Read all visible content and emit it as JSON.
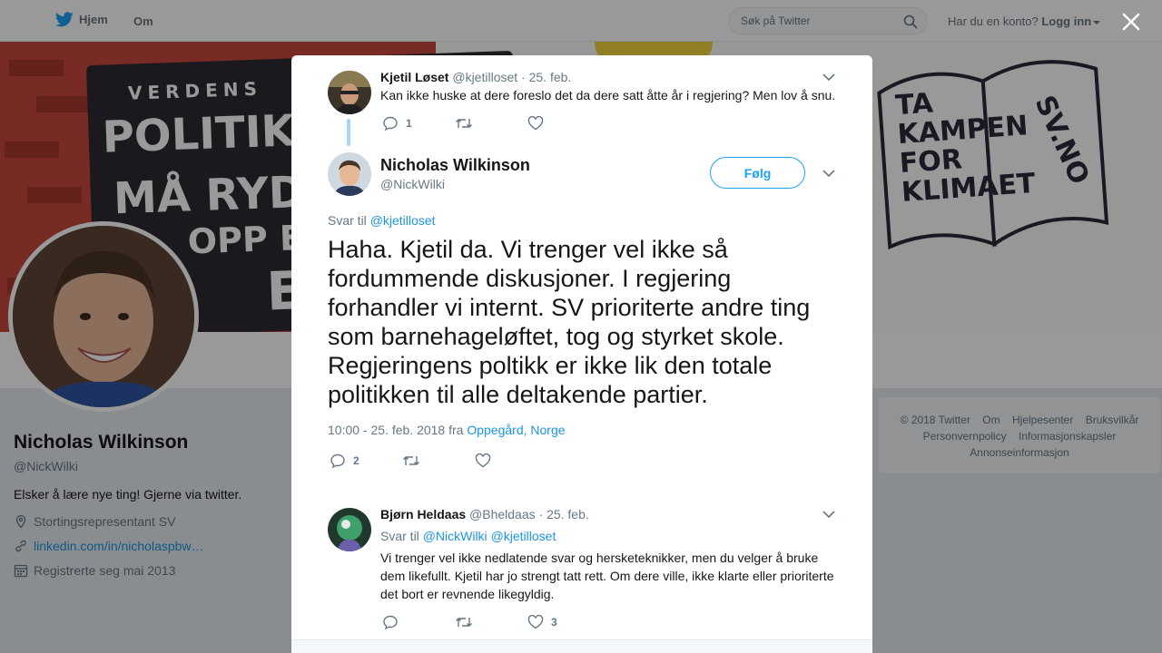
{
  "nav": {
    "home_label": "Hjem",
    "about_label": "Om",
    "search_placeholder": "Søk på Twitter",
    "account_prompt": "Har du en konto?",
    "login_label": "Logg inn"
  },
  "banner": {
    "sign_line1": "VERDENS",
    "sign_line2": "POLITIKERE",
    "sign_line3": "MÅ RYDDE",
    "sign_line4": "OPP ETTER",
    "sign_line5": "EG",
    "book_left": [
      "TA",
      "KAMPEN",
      "FOR",
      "KLIMAET"
    ],
    "book_right": "SV.NO"
  },
  "profile": {
    "name": "Nicholas Wilkinson",
    "handle": "@NickWilki",
    "bio": "Elsker å lære nye ting! Gjerne via twitter.",
    "location": "Stortingsrepresentant SV",
    "website": "linkedin.com/in/nicholaspbw…",
    "joined": "Registrerte seg mai 2013"
  },
  "footer": {
    "links": [
      "© 2018 Twitter",
      "Om",
      "Hjelpesenter",
      "Bruksvilkår",
      "Personvernpolicy",
      "Informasjonskapsler",
      "Annonseinformasjon"
    ]
  },
  "thread": {
    "parent": {
      "name": "Kjetil Løset",
      "handle": "@kjetilloset",
      "date": "· 25. feb.",
      "text": "Kan ikke huske at dere foreslo det da dere satt åtte år i regjering? Men lov å snu.",
      "replies": "1",
      "retweets": "",
      "likes": ""
    },
    "main": {
      "name": "Nicholas Wilkinson",
      "handle": "@NickWilki",
      "follow_label": "Følg",
      "reply_prefix": "Svar til",
      "reply_to": "@kjetilloset",
      "text": "Haha. Kjetil da. Vi trenger vel ikke så fordummende diskusjoner. I regjering forhandler vi internt. SV prioriterte andre ting som barnehageløftet, tog og styrket skole. Regjeringens poltikk er ikke lik den totale politikken til alle deltakende partier.",
      "timestamp": "10:00 - 25. feb. 2018 fra",
      "location": "Oppegård, Norge",
      "replies": "2",
      "retweets": "",
      "likes": ""
    },
    "reply": {
      "name": "Bjørn Heldaas",
      "handle": "@Bheldaas",
      "date": "· 25. feb.",
      "reply_prefix": "Svar til",
      "reply_to_1": "@NickWilki",
      "reply_to_2": "@kjetilloset",
      "text": "Vi trenger vel ikke nedlatende svar og hersketeknikker, men du velger å bruke dem likefullt. Kjetil har jo strengt tatt rett. Om dere ville, ikke klarte eller prioriterte det bort er revnende likegyldig.",
      "replies": "",
      "retweets": "",
      "likes": "3"
    }
  },
  "colors": {
    "accent": "#1da1f2",
    "link": "#1b95e0",
    "muted": "#657786"
  }
}
